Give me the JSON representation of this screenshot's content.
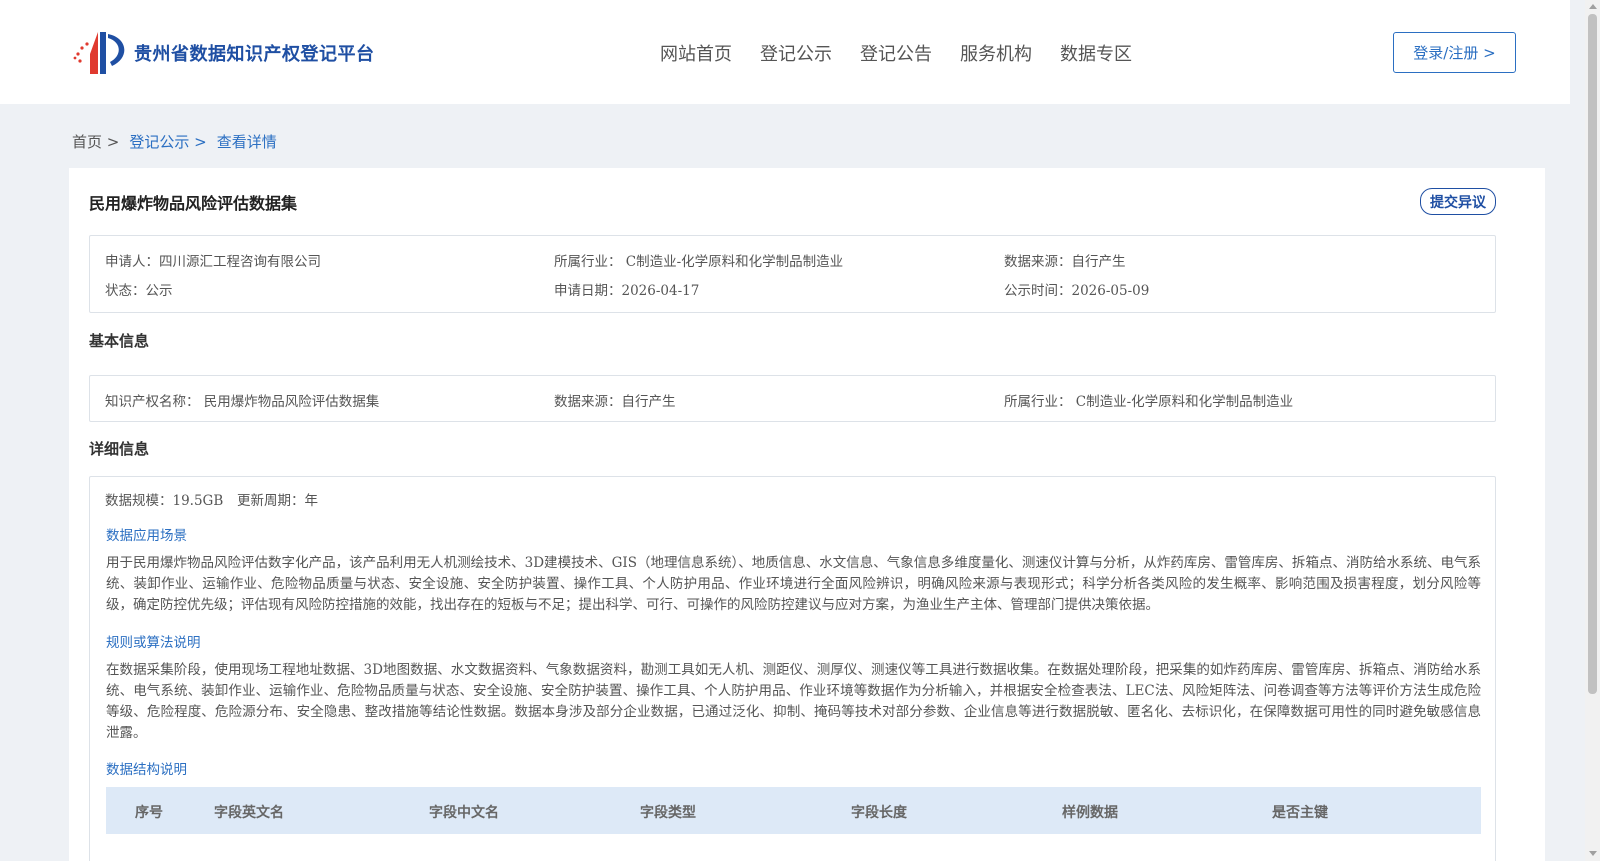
{
  "header": {
    "logo_text": "贵州省数据知识产权登记平台",
    "nav": [
      "网站首页",
      "登记公示",
      "登记公告",
      "服务机构",
      "数据专区"
    ],
    "login_label": "登录/注册 >"
  },
  "breadcrumb": {
    "home": "首页 >",
    "publicity": "登记公示 >",
    "current": "查看详情"
  },
  "record": {
    "title": "民用爆炸物品风险评估数据集",
    "objection_label": "提交异议",
    "summary": {
      "applicant": "申请人：四川源汇工程咨询有限公司",
      "industry": "所属行业： C制造业-化学原料和化学制品制造业",
      "source": "数据来源：自行产生",
      "status": "状态：公示",
      "apply_date": "申请日期：2026-04-17",
      "publicity_time": "公示时间：2026-05-09"
    }
  },
  "basic": {
    "section_title": "基本信息",
    "ip_name": "知识产权名称： 民用爆炸物品风险评估数据集",
    "source": "数据来源：自行产生",
    "industry": "所属行业： C制造业-化学原料和化学制品制造业"
  },
  "detail": {
    "section_title": "详细信息",
    "scale": "数据规模：19.5GB",
    "update_cycle": "更新周期：年",
    "scenario_title": "数据应用场景",
    "scenario_text": "用于民用爆炸物品风险评估数字化产品，该产品利用无人机测绘技术、3D建模技术、GIS（地理信息系统）、地质信息、水文信息、气象信息多维度量化、测速仪计算与分析，从炸药库房、雷管库房、拆箱点、消防给水系统、电气系统、装卸作业、运输作业、危险物品质量与状态、安全设施、安全防护装置、操作工具、个人防护用品、作业环境进行全面风险辨识，明确风险来源与表现形式；科学分析各类风险的发生概率、影响范围及损害程度，划分风险等级，确定防控优先级；评估现有风险防控措施的效能，找出存在的短板与不足；提出科学、可行、可操作的风险防控建议与应对方案，为渔业生产主体、管理部门提供决策依据。",
    "rules_title": "规则或算法说明",
    "rules_text": "在数据采集阶段，使用现场工程地址数据、3D地图数据、水文数据资料、气象数据资料，勘测工具如无人机、测距仪、测厚仪、测速仪等工具进行数据收集。在数据处理阶段，把采集的如炸药库房、雷管库房、拆箱点、消防给水系统、电气系统、装卸作业、运输作业、危险物品质量与状态、安全设施、安全防护装置、操作工具、个人防护用品、作业环境等数据作为分析输入，并根据安全检查表法、LEC法、风险矩阵法、问卷调查等方法等评价方法生成危险等级、危险程度、危险源分布、安全隐患、整改措施等结论性数据。数据本身涉及部分企业数据，已通过泛化、抑制、掩码等技术对部分参数、企业信息等进行数据脱敏、匿名化、去标识化，在保障数据可用性的同时避免敏感信息泄露。",
    "structure_title": "数据结构说明",
    "table_headers": [
      "序号",
      "字段英文名",
      "字段中文名",
      "字段类型",
      "字段长度",
      "样例数据",
      "是否主键"
    ]
  },
  "colors": {
    "brand_blue": "#1f4fa3",
    "link_blue": "#2b6fc2",
    "table_head_bg": "#dde9f7"
  }
}
